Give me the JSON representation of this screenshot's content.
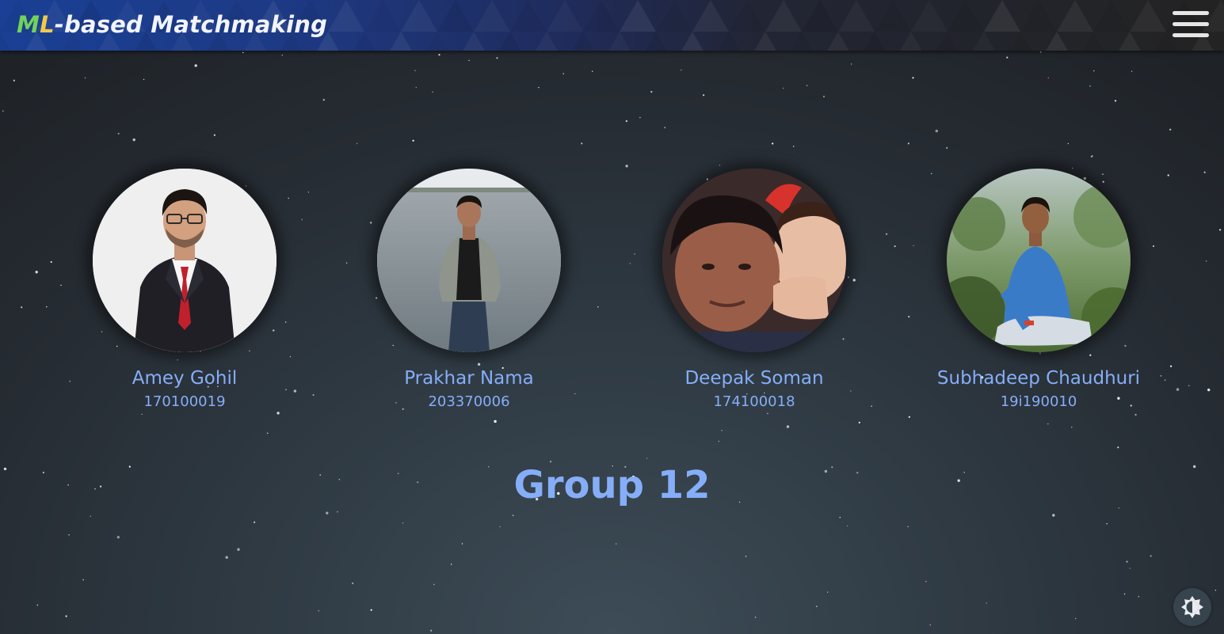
{
  "header": {
    "brand_m": "M",
    "brand_l": "L",
    "brand_rest": "-based Matchmaking",
    "menu_icon": "hamburger-menu-icon"
  },
  "team": {
    "members": [
      {
        "name": "Amey Gohil",
        "id": "170100019",
        "photo": "portrait-photo"
      },
      {
        "name": "Prakhar Nama",
        "id": "203370006",
        "photo": "portrait-photo"
      },
      {
        "name": "Deepak Soman",
        "id": "174100018",
        "photo": "portrait-photo"
      },
      {
        "name": "Subhadeep Chaudhuri",
        "id": "19i190010",
        "photo": "portrait-photo"
      }
    ],
    "group_title": "Group 12"
  },
  "theme_toggle": {
    "icon": "brightness-toggle-icon"
  },
  "colors": {
    "accent_text": "#86aef8",
    "header_blue": "#1a3f94",
    "header_dark": "#232323",
    "brand_green": "#72d25a",
    "brand_yellow": "#f1c94a",
    "background": "#2f3a43"
  }
}
